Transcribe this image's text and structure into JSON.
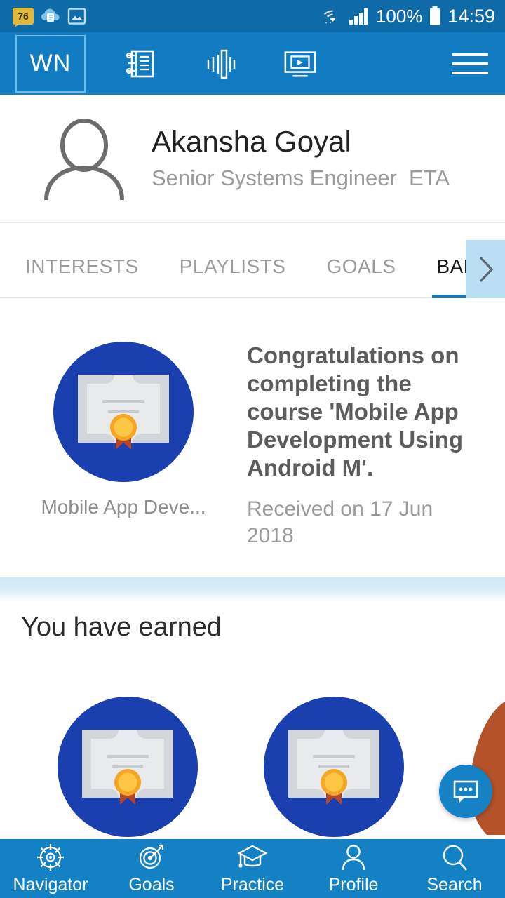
{
  "status_bar": {
    "notification_count": "76",
    "left_icons": [
      "calendar-badge-icon",
      "cloud-file-icon",
      "gallery-icon"
    ],
    "wifi_icon": "wifi-icon",
    "signal_icon": "signal-bars-icon",
    "battery_percent": "100%",
    "battery_icon": "battery-full-icon",
    "time": "14:59",
    "background_color": "#0f6aa8"
  },
  "app_bar": {
    "logo_text": "WN",
    "icons": [
      {
        "name": "articles-icon",
        "label": "Articles"
      },
      {
        "name": "audio-waveform-icon",
        "label": "Audio"
      },
      {
        "name": "video-player-icon",
        "label": "Video"
      }
    ],
    "menu_icon": "hamburger-menu-icon",
    "background_color": "#117cc1"
  },
  "profile": {
    "avatar_icon": "person-avatar-icon",
    "name": "Akansha Goyal",
    "role": "Senior Systems Engineer  ETA"
  },
  "tabs": {
    "items": [
      {
        "label": "INTERESTS",
        "active": false
      },
      {
        "label": "PLAYLISTS",
        "active": false
      },
      {
        "label": "GOALS",
        "active": false
      },
      {
        "label": "BADGE",
        "active": true
      }
    ],
    "scroll_next_icon": "chevron-right-icon",
    "active_underline_color": "#1a77b0",
    "scroll_button_color": "#badef2"
  },
  "badge_card": {
    "badge_icon": "certificate-badge-icon",
    "caption": "Mobile App Deve...",
    "title": "Congratulations on completing the course 'Mobile App Development Using Android M'.",
    "date": "Received on 17 Jun 2018",
    "badge_circle_color": "#1a3faf"
  },
  "earned_section": {
    "title": "You have earned",
    "badges": [
      {
        "icon": "certificate-badge-icon",
        "circle_color": "#1a3faf"
      },
      {
        "icon": "certificate-badge-icon",
        "circle_color": "#1a3faf"
      },
      {
        "icon": "partial-badge-icon",
        "circle_color": "#b4522a"
      }
    ]
  },
  "chat_fab": {
    "icon": "chat-bubble-icon",
    "color": "#1681c4"
  },
  "bottom_nav": {
    "background_color": "#1481c4",
    "items": [
      {
        "label": "Navigator",
        "icon": "ship-wheel-icon"
      },
      {
        "label": "Goals",
        "icon": "target-arrow-icon"
      },
      {
        "label": "Practice",
        "icon": "graduation-cap-icon"
      },
      {
        "label": "Profile",
        "icon": "person-icon"
      },
      {
        "label": "Search",
        "icon": "search-icon"
      }
    ]
  }
}
